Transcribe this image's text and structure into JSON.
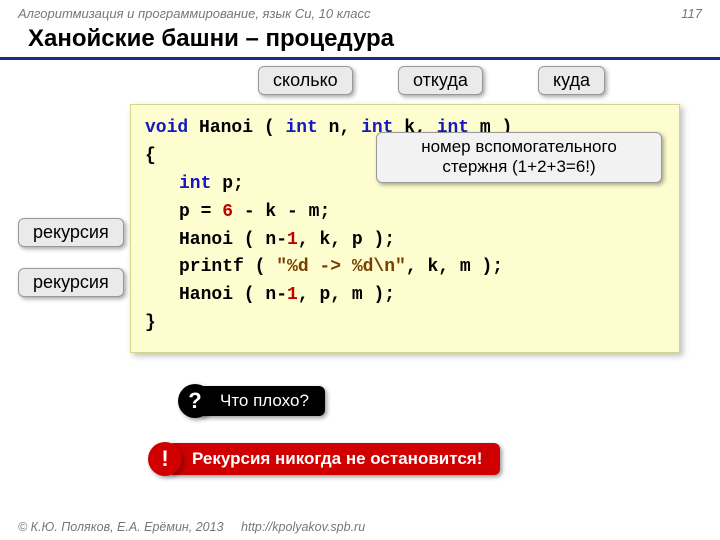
{
  "header": {
    "course": "Алгоритмизация и программирование, язык Си, 10 класс",
    "page": "117"
  },
  "title": "Ханойские башни – процедура",
  "labels": {
    "skolko": "сколько",
    "otkuda": "откуда",
    "kuda": "куда",
    "rec1": "рекурсия",
    "rec2": "рекурсия",
    "aux1": "номер вспомогательного",
    "aux2": "стержня (1+2+3=6!)"
  },
  "code": {
    "kw_void": "void",
    "fn": " Hanoi ( ",
    "kw_int1": "int",
    "p_n": " n, ",
    "kw_int2": "int",
    "p_k": " k, ",
    "kw_int3": "int",
    "p_m": " m )",
    "lbrace": "{",
    "kw_int4": "int",
    "decl_p": " p;",
    "assign_pre": "p = ",
    "six": "6",
    "assign_post": " - k - m;",
    "call1_pre": "Hanoi ( n-",
    "one_a": "1",
    "call1_post": ", k, p );",
    "printf_pre": "printf ( ",
    "fmt": "\"%d -> %d\\n\"",
    "printf_post": ", k, m );",
    "call2_pre": "Hanoi ( n-",
    "one_b": "1",
    "call2_post": ", p, m );",
    "rbrace": "}"
  },
  "prompts": {
    "q_mark": "?",
    "q_text": "Что плохо?",
    "bang": "!",
    "warn": "Рекурсия никогда не остановится!"
  },
  "footer": {
    "copyright": "© К.Ю. Поляков, Е.А. Ерёмин, 2013",
    "url": "http://kpolyakov.spb.ru"
  }
}
